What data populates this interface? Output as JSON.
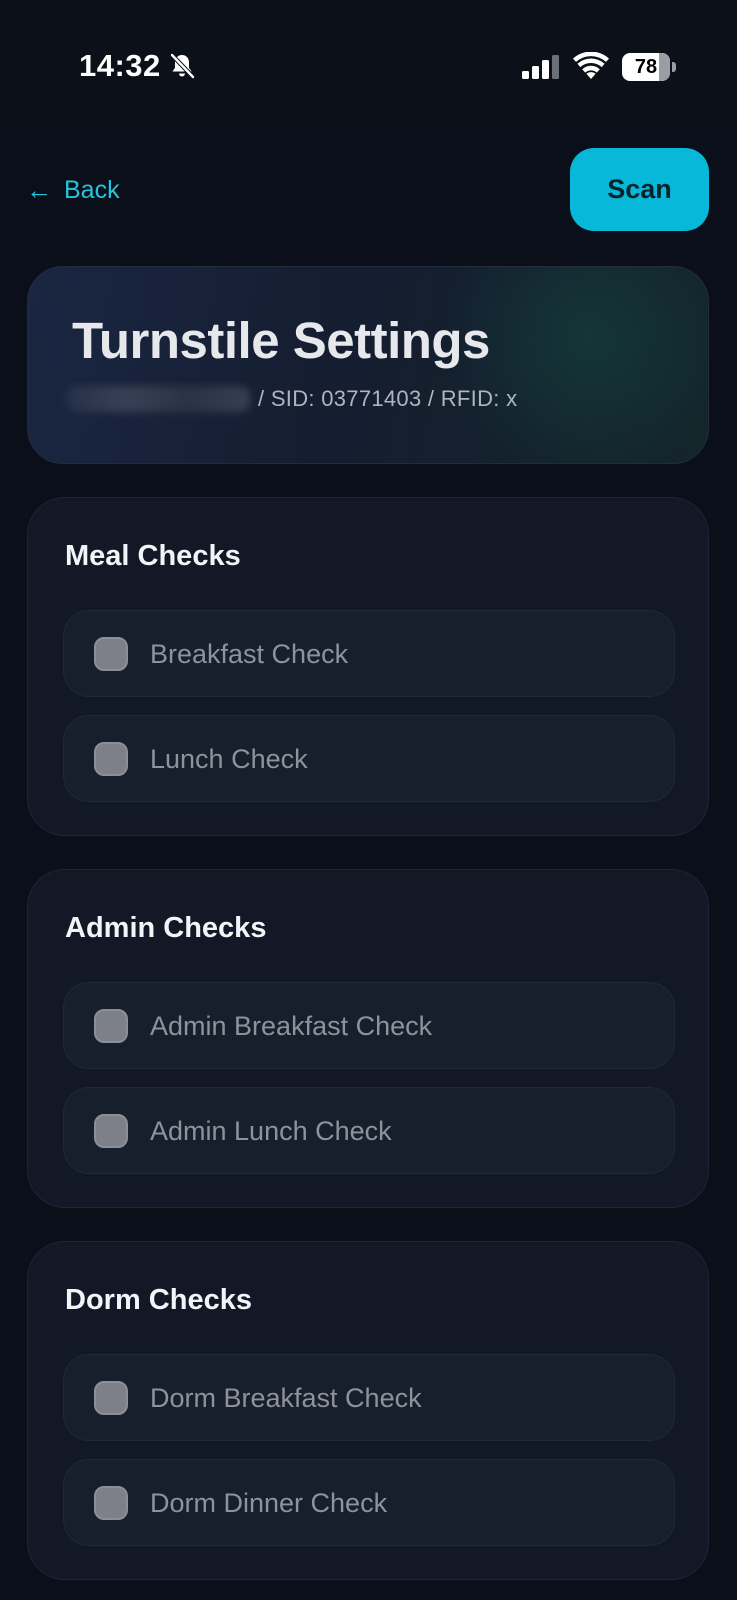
{
  "status_bar": {
    "time": "14:32",
    "battery_level": 78,
    "battery_text": "78",
    "icons": [
      "bell-off-icon",
      "cellular-signal-icon",
      "wifi-icon",
      "battery-icon"
    ]
  },
  "nav": {
    "back_arrow": "←",
    "back_label": "Back",
    "scan_label": "Scan"
  },
  "header": {
    "title": "Turnstile Settings",
    "id_line": "/ SID: 03771403 / RFID: x"
  },
  "sections": [
    {
      "title": "Meal Checks",
      "items": [
        {
          "label": "Breakfast Check",
          "checked": false
        },
        {
          "label": "Lunch Check",
          "checked": false
        }
      ]
    },
    {
      "title": "Admin Checks",
      "items": [
        {
          "label": "Admin Breakfast Check",
          "checked": false
        },
        {
          "label": "Admin Lunch Check",
          "checked": false
        }
      ]
    },
    {
      "title": "Dorm Checks",
      "items": [
        {
          "label": "Dorm Breakfast Check",
          "checked": false
        },
        {
          "label": "Dorm Dinner Check",
          "checked": false
        }
      ]
    }
  ],
  "colors": {
    "accent": "#08b8d8",
    "link": "#22c4de",
    "background": "#0b0f1a",
    "card": "#121826",
    "checkbox": "#7d8089"
  }
}
